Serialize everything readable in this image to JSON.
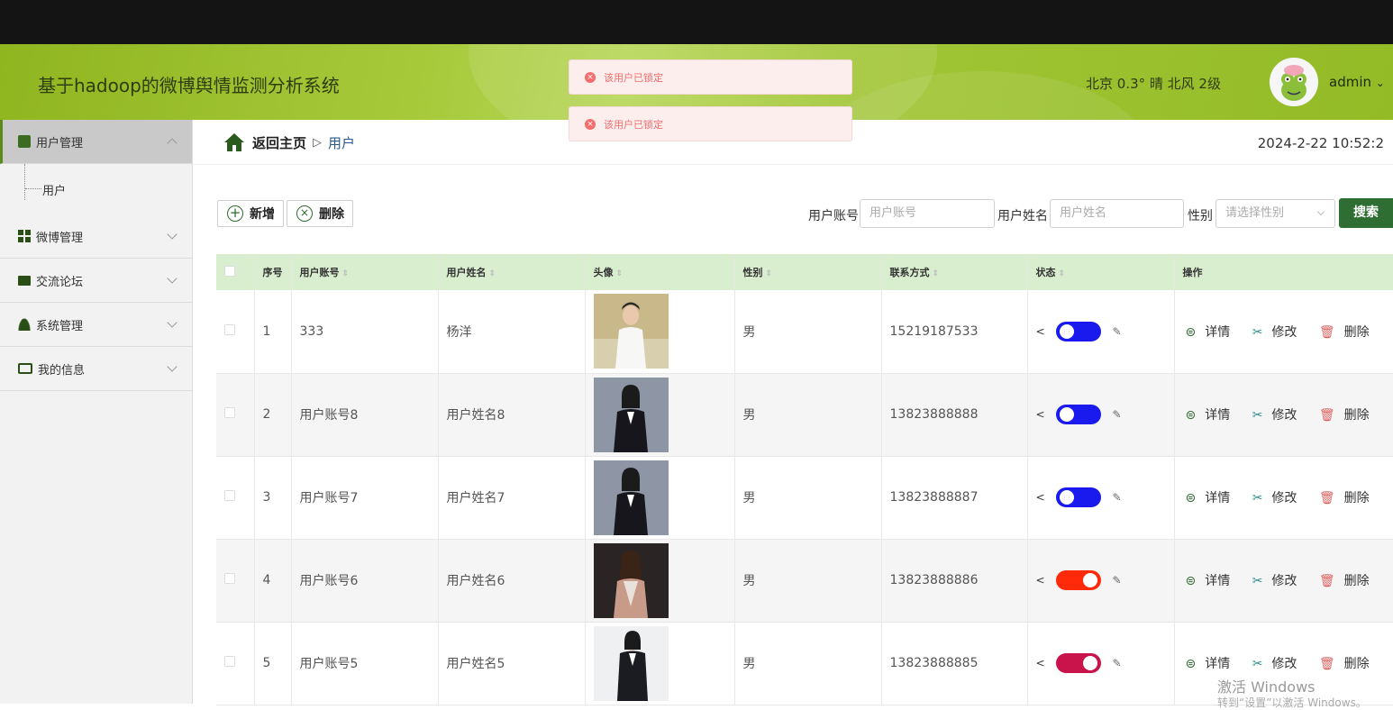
{
  "app": {
    "title": "基于hadoop的微博舆情监测分析系统",
    "weather": "北京 0.3° 晴 北风 2级",
    "user": "admin",
    "user_chevron": "⌄"
  },
  "toasts": [
    "该用户已锁定",
    "该用户已锁定"
  ],
  "sidebar": {
    "items": [
      {
        "label": "用户管理"
      },
      {
        "label": "微博管理"
      },
      {
        "label": "交流论坛"
      },
      {
        "label": "系统管理"
      },
      {
        "label": "我的信息"
      }
    ],
    "sub_item": "用户"
  },
  "breadcrumb": {
    "home": "返回主页",
    "sep": "▷",
    "current": "用户"
  },
  "datetime": "2024-2-22 10:52:2",
  "toolbar": {
    "add": "新增",
    "delete": "删除",
    "search": "搜索"
  },
  "filters": {
    "account_label": "用户账号",
    "account_placeholder": "用户账号",
    "name_label": "用户姓名",
    "name_placeholder": "用户姓名",
    "gender_label": "性别",
    "gender_placeholder": "请选择性别"
  },
  "table": {
    "columns": [
      "序号",
      "用户账号",
      "用户姓名",
      "头像",
      "性别",
      "联系方式",
      "状态",
      "操作"
    ],
    "rows": [
      {
        "no": "1",
        "account": "333",
        "name": "杨洋",
        "gender": "男",
        "phone": "15219187533",
        "status_on": false,
        "status_color": "#1a1aee"
      },
      {
        "no": "2",
        "account": "用户账号8",
        "name": "用户姓名8",
        "gender": "男",
        "phone": "13823888888",
        "status_on": false,
        "status_color": "#1a1aee"
      },
      {
        "no": "3",
        "account": "用户账号7",
        "name": "用户姓名7",
        "gender": "男",
        "phone": "13823888887",
        "status_on": false,
        "status_color": "#1a1aee"
      },
      {
        "no": "4",
        "account": "用户账号6",
        "name": "用户姓名6",
        "gender": "男",
        "phone": "13823888886",
        "status_on": true,
        "status_color": "#ff2a0a"
      },
      {
        "no": "5",
        "account": "用户账号5",
        "name": "用户姓名5",
        "gender": "男",
        "phone": "13823888885",
        "status_on": true,
        "status_color": "#c8144a"
      }
    ],
    "actions": {
      "detail": "详情",
      "edit": "修改",
      "delete": "删除"
    }
  },
  "watermark": {
    "line1": "激活 Windows",
    "line2": "转到“设置”以激活 Windows。"
  }
}
